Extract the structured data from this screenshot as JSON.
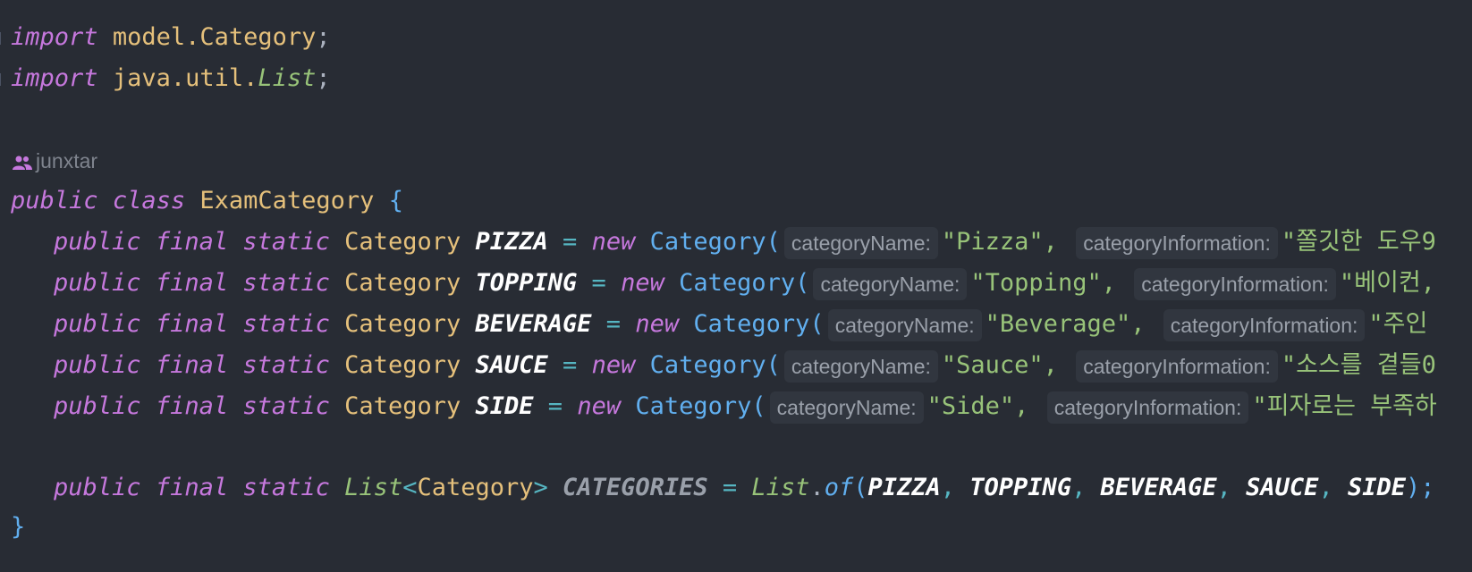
{
  "code": {
    "import1": {
      "kw": "import",
      "path": "model.",
      "cls": "Category",
      "semi": ";"
    },
    "import2": {
      "kw": "import",
      "path": "java.util.",
      "cls": "List",
      "semi": ";"
    },
    "author": "junxtar",
    "classdecl": {
      "public": "public",
      "class": "class",
      "name": "ExamCategory",
      "brace": "{"
    },
    "fields": [
      {
        "name": "PIZZA",
        "value": "\"Pizza\",",
        "info": "\"쫄깃한 도우9"
      },
      {
        "name": "TOPPING",
        "value": "\"Topping\",",
        "info": "\"베이컨,"
      },
      {
        "name": "BEVERAGE",
        "value": "\"Beverage\",",
        "info": "\"주인"
      },
      {
        "name": "SAUCE",
        "value": "\"Sauce\",",
        "info": "\"소스를 곁들0"
      },
      {
        "name": "SIDE",
        "value": "\"Side\",",
        "info": "\"피자로는 부족하"
      }
    ],
    "field_kw": {
      "public": "public",
      "final": "final",
      "static": "static",
      "type": "Category",
      "eq": "=",
      "new": "new",
      "ctor": "Category("
    },
    "hints": {
      "name": "categoryName:",
      "info": "categoryInformation:"
    },
    "categories_line": {
      "public": "public",
      "final": "final",
      "static": "static",
      "list": "List",
      "lt": "<",
      "type": "Category",
      "gt": ">",
      "name": "CATEGORIES",
      "eq": "=",
      "list2": "List",
      "dot": ".",
      "of": "of",
      "open": "(",
      "args": [
        "PIZZA",
        "TOPPING",
        "BEVERAGE",
        "SAUCE",
        "SIDE"
      ],
      "sep": ", ",
      "close": ");"
    },
    "closing_brace": "}"
  },
  "colors": {
    "background": "#282c34",
    "keyword": "#c678dd",
    "type": "#e5c07b",
    "string": "#98c379",
    "function": "#61afef"
  }
}
